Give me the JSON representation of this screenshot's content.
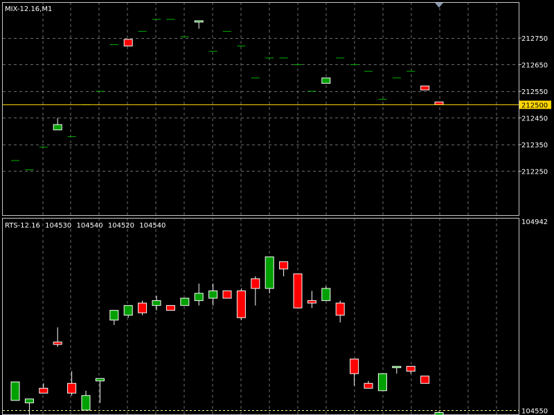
{
  "colors": {
    "background": "#000000",
    "grid": "#6e6e6e",
    "frame": "#c8c8c8",
    "bull": "#00a000",
    "bear": "#ff0000",
    "bull_flat": "#00b400",
    "level_line": "#ffd700",
    "level_badge": "#ffd700",
    "dashed_level": "#ffff80",
    "marker": "#8a9ab0"
  },
  "top_panel": {
    "header": "MIX-12.16,M1",
    "price_labels": [
      "212750",
      "212650",
      "212550",
      "212450",
      "212350",
      "212250"
    ],
    "level_label": "212500"
  },
  "bottom_panel": {
    "header_symbol": "RTS-12.16",
    "header_values": [
      "104530",
      "104540",
      "104520",
      "104540"
    ],
    "top_label": "104942",
    "bottom_label": "104550"
  },
  "chart_data": [
    {
      "type": "candlestick",
      "title": "MIX-12.16,M1",
      "ylim": [
        212085,
        212885
      ],
      "y_ticks": [
        212750,
        212650,
        212550,
        212450,
        212350,
        212250
      ],
      "level": 212500,
      "candles": [
        {
          "o": 212290,
          "h": 212290,
          "l": 212290,
          "c": 212290
        },
        {
          "o": 212255,
          "h": 212255,
          "l": 212255,
          "c": 212255
        },
        {
          "o": 212340,
          "h": 212340,
          "l": 212340,
          "c": 212340
        },
        {
          "o": 212405,
          "h": 212450,
          "l": 212405,
          "c": 212425
        },
        {
          "o": 212380,
          "h": 212380,
          "l": 212380,
          "c": 212380
        },
        {
          "o": 212500,
          "h": 212500,
          "l": 212500,
          "c": 212500
        },
        {
          "o": 212550,
          "h": 212550,
          "l": 212550,
          "c": 212550
        },
        {
          "o": 212725,
          "h": 212725,
          "l": 212725,
          "c": 212725
        },
        {
          "o": 212745,
          "h": 212745,
          "l": 212720,
          "c": 212720
        },
        {
          "o": 212775,
          "h": 212775,
          "l": 212775,
          "c": 212775
        },
        {
          "o": 212820,
          "h": 212820,
          "l": 212820,
          "c": 212820
        },
        {
          "o": 212820,
          "h": 212820,
          "l": 212820,
          "c": 212820
        },
        {
          "o": 212755,
          "h": 212755,
          "l": 212755,
          "c": 212755
        },
        {
          "o": 212815,
          "h": 212815,
          "l": 212785,
          "c": 212815
        },
        {
          "o": 212700,
          "h": 212700,
          "l": 212700,
          "c": 212700
        },
        {
          "o": 212775,
          "h": 212775,
          "l": 212775,
          "c": 212775
        },
        {
          "o": 212720,
          "h": 212720,
          "l": 212720,
          "c": 212720
        },
        {
          "o": 212600,
          "h": 212600,
          "l": 212600,
          "c": 212600
        },
        {
          "o": 212675,
          "h": 212675,
          "l": 212675,
          "c": 212675
        },
        {
          "o": 212675,
          "h": 212675,
          "l": 212675,
          "c": 212675
        },
        {
          "o": 212650,
          "h": 212650,
          "l": 212650,
          "c": 212650
        },
        {
          "o": 212550,
          "h": 212550,
          "l": 212550,
          "c": 212550
        },
        {
          "o": 212580,
          "h": 212600,
          "l": 212580,
          "c": 212600
        },
        {
          "o": 212675,
          "h": 212675,
          "l": 212675,
          "c": 212675
        },
        {
          "o": 212650,
          "h": 212650,
          "l": 212650,
          "c": 212650
        },
        {
          "o": 212625,
          "h": 212625,
          "l": 212625,
          "c": 212625
        },
        {
          "o": 212520,
          "h": 212520,
          "l": 212520,
          "c": 212520
        },
        {
          "o": 212600,
          "h": 212600,
          "l": 212600,
          "c": 212600
        },
        {
          "o": 212625,
          "h": 212625,
          "l": 212625,
          "c": 212625
        },
        {
          "o": 212570,
          "h": 212570,
          "l": 212555,
          "c": 212555
        },
        {
          "o": 212510,
          "h": 212510,
          "l": 212500,
          "c": 212500
        }
      ]
    },
    {
      "type": "candlestick",
      "title": "RTS-12.16",
      "ylim": [
        104540,
        104945
      ],
      "level": 104550,
      "candles": [
        {
          "o": 104570,
          "h": 104608,
          "l": 104570,
          "c": 104608
        },
        {
          "o": 104565,
          "h": 104573,
          "l": 104530,
          "c": 104573
        },
        {
          "o": 104595,
          "h": 104605,
          "l": 104585,
          "c": 104585
        },
        {
          "o": 104690,
          "h": 104720,
          "l": 104680,
          "c": 104685
        },
        {
          "o": 104605,
          "h": 104630,
          "l": 104580,
          "c": 104585
        },
        {
          "o": 104550,
          "h": 104590,
          "l": 104550,
          "c": 104580
        },
        {
          "o": 104610,
          "h": 104615,
          "l": 104565,
          "c": 104615
        },
        {
          "o": 104735,
          "h": 104745,
          "l": 104725,
          "c": 104755
        },
        {
          "o": 104745,
          "h": 104765,
          "l": 104740,
          "c": 104765
        },
        {
          "o": 104770,
          "h": 104775,
          "l": 104745,
          "c": 104750
        },
        {
          "o": 104765,
          "h": 104785,
          "l": 104755,
          "c": 104775
        },
        {
          "o": 104765,
          "h": 104765,
          "l": 104755,
          "c": 104755
        },
        {
          "o": 104765,
          "h": 104780,
          "l": 104765,
          "c": 104780
        },
        {
          "o": 104775,
          "h": 104810,
          "l": 104765,
          "c": 104790
        },
        {
          "o": 104780,
          "h": 104810,
          "l": 104765,
          "c": 104795
        },
        {
          "o": 104795,
          "h": 104795,
          "l": 104780,
          "c": 104780
        },
        {
          "o": 104795,
          "h": 104800,
          "l": 104735,
          "c": 104740
        },
        {
          "o": 104820,
          "h": 104825,
          "l": 104765,
          "c": 104800
        },
        {
          "o": 104800,
          "h": 104860,
          "l": 104790,
          "c": 104865
        },
        {
          "o": 104855,
          "h": 104855,
          "l": 104825,
          "c": 104840
        },
        {
          "o": 104830,
          "h": 104830,
          "l": 104760,
          "c": 104760
        },
        {
          "o": 104775,
          "h": 104795,
          "l": 104760,
          "c": 104770
        },
        {
          "o": 104775,
          "h": 104805,
          "l": 104775,
          "c": 104800
        },
        {
          "o": 104770,
          "h": 104775,
          "l": 104730,
          "c": 104745
        },
        {
          "o": 104655,
          "h": 104655,
          "l": 104600,
          "c": 104625
        },
        {
          "o": 104605,
          "h": 104610,
          "l": 104595,
          "c": 104595
        },
        {
          "o": 104590,
          "h": 104620,
          "l": 104590,
          "c": 104625
        },
        {
          "o": 104640,
          "h": 104640,
          "l": 104625,
          "c": 104640
        },
        {
          "o": 104640,
          "h": 104640,
          "l": 104625,
          "c": 104630
        },
        {
          "o": 104620,
          "h": 104620,
          "l": 104605,
          "c": 104605
        },
        {
          "o": 104540,
          "h": 104548,
          "l": 104535,
          "c": 104545
        }
      ]
    }
  ]
}
